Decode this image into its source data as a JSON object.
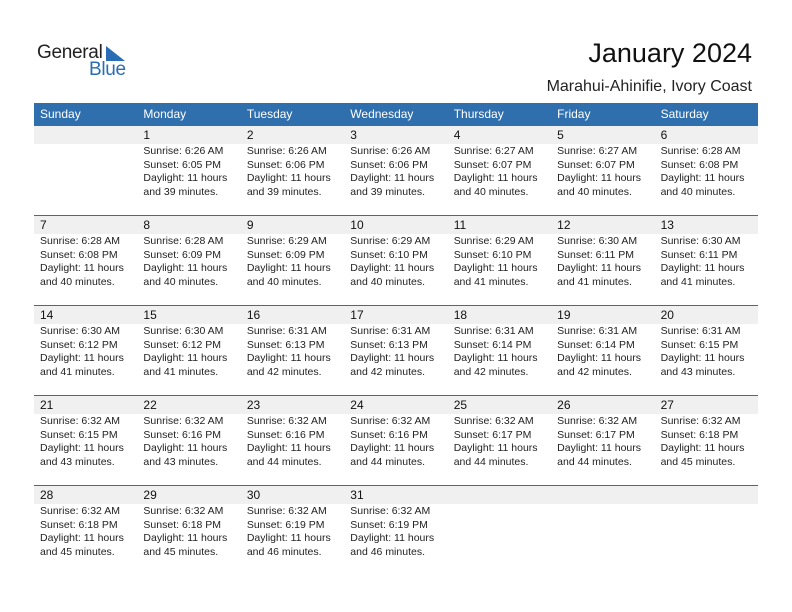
{
  "logo": {
    "general": "General",
    "blue": "Blue",
    "accent": "#2a6db5"
  },
  "header": {
    "title": "January 2024",
    "location": "Marahui-Ahinifie, Ivory Coast"
  },
  "colors": {
    "header_bg": "#2f6fad",
    "day_bg": "#f0f0f0"
  },
  "weekdays": [
    "Sunday",
    "Monday",
    "Tuesday",
    "Wednesday",
    "Thursday",
    "Friday",
    "Saturday"
  ],
  "weeks": [
    [
      null,
      {
        "day": "1",
        "sunrise": "Sunrise: 6:26 AM",
        "sunset": "Sunset: 6:05 PM",
        "daylight1": "Daylight: 11 hours",
        "daylight2": "and 39 minutes."
      },
      {
        "day": "2",
        "sunrise": "Sunrise: 6:26 AM",
        "sunset": "Sunset: 6:06 PM",
        "daylight1": "Daylight: 11 hours",
        "daylight2": "and 39 minutes."
      },
      {
        "day": "3",
        "sunrise": "Sunrise: 6:26 AM",
        "sunset": "Sunset: 6:06 PM",
        "daylight1": "Daylight: 11 hours",
        "daylight2": "and 39 minutes."
      },
      {
        "day": "4",
        "sunrise": "Sunrise: 6:27 AM",
        "sunset": "Sunset: 6:07 PM",
        "daylight1": "Daylight: 11 hours",
        "daylight2": "and 40 minutes."
      },
      {
        "day": "5",
        "sunrise": "Sunrise: 6:27 AM",
        "sunset": "Sunset: 6:07 PM",
        "daylight1": "Daylight: 11 hours",
        "daylight2": "and 40 minutes."
      },
      {
        "day": "6",
        "sunrise": "Sunrise: 6:28 AM",
        "sunset": "Sunset: 6:08 PM",
        "daylight1": "Daylight: 11 hours",
        "daylight2": "and 40 minutes."
      }
    ],
    [
      {
        "day": "7",
        "sunrise": "Sunrise: 6:28 AM",
        "sunset": "Sunset: 6:08 PM",
        "daylight1": "Daylight: 11 hours",
        "daylight2": "and 40 minutes."
      },
      {
        "day": "8",
        "sunrise": "Sunrise: 6:28 AM",
        "sunset": "Sunset: 6:09 PM",
        "daylight1": "Daylight: 11 hours",
        "daylight2": "and 40 minutes."
      },
      {
        "day": "9",
        "sunrise": "Sunrise: 6:29 AM",
        "sunset": "Sunset: 6:09 PM",
        "daylight1": "Daylight: 11 hours",
        "daylight2": "and 40 minutes."
      },
      {
        "day": "10",
        "sunrise": "Sunrise: 6:29 AM",
        "sunset": "Sunset: 6:10 PM",
        "daylight1": "Daylight: 11 hours",
        "daylight2": "and 40 minutes."
      },
      {
        "day": "11",
        "sunrise": "Sunrise: 6:29 AM",
        "sunset": "Sunset: 6:10 PM",
        "daylight1": "Daylight: 11 hours",
        "daylight2": "and 41 minutes."
      },
      {
        "day": "12",
        "sunrise": "Sunrise: 6:30 AM",
        "sunset": "Sunset: 6:11 PM",
        "daylight1": "Daylight: 11 hours",
        "daylight2": "and 41 minutes."
      },
      {
        "day": "13",
        "sunrise": "Sunrise: 6:30 AM",
        "sunset": "Sunset: 6:11 PM",
        "daylight1": "Daylight: 11 hours",
        "daylight2": "and 41 minutes."
      }
    ],
    [
      {
        "day": "14",
        "sunrise": "Sunrise: 6:30 AM",
        "sunset": "Sunset: 6:12 PM",
        "daylight1": "Daylight: 11 hours",
        "daylight2": "and 41 minutes."
      },
      {
        "day": "15",
        "sunrise": "Sunrise: 6:30 AM",
        "sunset": "Sunset: 6:12 PM",
        "daylight1": "Daylight: 11 hours",
        "daylight2": "and 41 minutes."
      },
      {
        "day": "16",
        "sunrise": "Sunrise: 6:31 AM",
        "sunset": "Sunset: 6:13 PM",
        "daylight1": "Daylight: 11 hours",
        "daylight2": "and 42 minutes."
      },
      {
        "day": "17",
        "sunrise": "Sunrise: 6:31 AM",
        "sunset": "Sunset: 6:13 PM",
        "daylight1": "Daylight: 11 hours",
        "daylight2": "and 42 minutes."
      },
      {
        "day": "18",
        "sunrise": "Sunrise: 6:31 AM",
        "sunset": "Sunset: 6:14 PM",
        "daylight1": "Daylight: 11 hours",
        "daylight2": "and 42 minutes."
      },
      {
        "day": "19",
        "sunrise": "Sunrise: 6:31 AM",
        "sunset": "Sunset: 6:14 PM",
        "daylight1": "Daylight: 11 hours",
        "daylight2": "and 42 minutes."
      },
      {
        "day": "20",
        "sunrise": "Sunrise: 6:31 AM",
        "sunset": "Sunset: 6:15 PM",
        "daylight1": "Daylight: 11 hours",
        "daylight2": "and 43 minutes."
      }
    ],
    [
      {
        "day": "21",
        "sunrise": "Sunrise: 6:32 AM",
        "sunset": "Sunset: 6:15 PM",
        "daylight1": "Daylight: 11 hours",
        "daylight2": "and 43 minutes."
      },
      {
        "day": "22",
        "sunrise": "Sunrise: 6:32 AM",
        "sunset": "Sunset: 6:16 PM",
        "daylight1": "Daylight: 11 hours",
        "daylight2": "and 43 minutes."
      },
      {
        "day": "23",
        "sunrise": "Sunrise: 6:32 AM",
        "sunset": "Sunset: 6:16 PM",
        "daylight1": "Daylight: 11 hours",
        "daylight2": "and 44 minutes."
      },
      {
        "day": "24",
        "sunrise": "Sunrise: 6:32 AM",
        "sunset": "Sunset: 6:16 PM",
        "daylight1": "Daylight: 11 hours",
        "daylight2": "and 44 minutes."
      },
      {
        "day": "25",
        "sunrise": "Sunrise: 6:32 AM",
        "sunset": "Sunset: 6:17 PM",
        "daylight1": "Daylight: 11 hours",
        "daylight2": "and 44 minutes."
      },
      {
        "day": "26",
        "sunrise": "Sunrise: 6:32 AM",
        "sunset": "Sunset: 6:17 PM",
        "daylight1": "Daylight: 11 hours",
        "daylight2": "and 44 minutes."
      },
      {
        "day": "27",
        "sunrise": "Sunrise: 6:32 AM",
        "sunset": "Sunset: 6:18 PM",
        "daylight1": "Daylight: 11 hours",
        "daylight2": "and 45 minutes."
      }
    ],
    [
      {
        "day": "28",
        "sunrise": "Sunrise: 6:32 AM",
        "sunset": "Sunset: 6:18 PM",
        "daylight1": "Daylight: 11 hours",
        "daylight2": "and 45 minutes."
      },
      {
        "day": "29",
        "sunrise": "Sunrise: 6:32 AM",
        "sunset": "Sunset: 6:18 PM",
        "daylight1": "Daylight: 11 hours",
        "daylight2": "and 45 minutes."
      },
      {
        "day": "30",
        "sunrise": "Sunrise: 6:32 AM",
        "sunset": "Sunset: 6:19 PM",
        "daylight1": "Daylight: 11 hours",
        "daylight2": "and 46 minutes."
      },
      {
        "day": "31",
        "sunrise": "Sunrise: 6:32 AM",
        "sunset": "Sunset: 6:19 PM",
        "daylight1": "Daylight: 11 hours",
        "daylight2": "and 46 minutes."
      },
      null,
      null,
      null
    ]
  ]
}
